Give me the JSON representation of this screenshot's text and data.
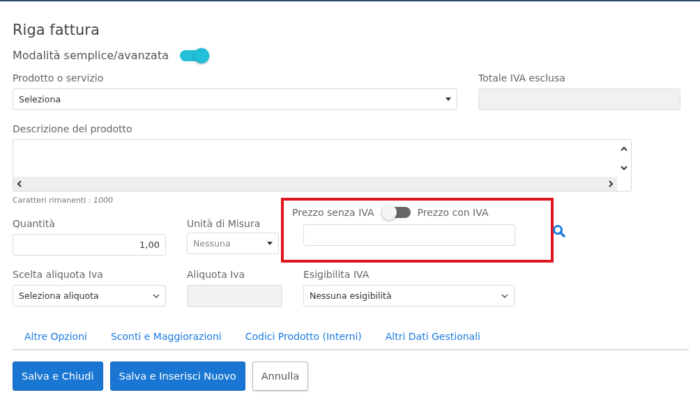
{
  "title": "Riga fattura",
  "mode_toggle": {
    "label": "Modalità semplice/avanzata",
    "on": true
  },
  "product": {
    "label": "Prodotto o servizio",
    "value": "Seleziona"
  },
  "total": {
    "label": "Totale IVA esclusa"
  },
  "description": {
    "label": "Descrizione del prodotto",
    "remaining": "Caratteri rimanenti : *1000*"
  },
  "quantity": {
    "label": "Quantità",
    "value": "1,00"
  },
  "unit": {
    "label": "Unità di Misura",
    "value": "Nessuna"
  },
  "price": {
    "label_without": "Prezzo senza IVA",
    "label_with": "Prezzo con IVA",
    "on": false
  },
  "vat_choice": {
    "label": "Scelta aliquota Iva",
    "value": "Seleziona aliquota"
  },
  "vat_rate": {
    "label": "Aliquota Iva"
  },
  "vat_due": {
    "label": "Esigibilita IVA",
    "value": "Nessuna esigibilità"
  },
  "links": [
    "Altre Opzioni",
    "Sconti e Maggiorazioni",
    "Codici Prodotto (Interni)",
    "Altri Dati Gestionali"
  ],
  "buttons": [
    {
      "label": "Salva e Chiudi",
      "kind": "primary"
    },
    {
      "label": "Salva e Inserisci Nuovo",
      "kind": "primary"
    },
    {
      "label": "Annulla",
      "kind": "secondary"
    }
  ]
}
